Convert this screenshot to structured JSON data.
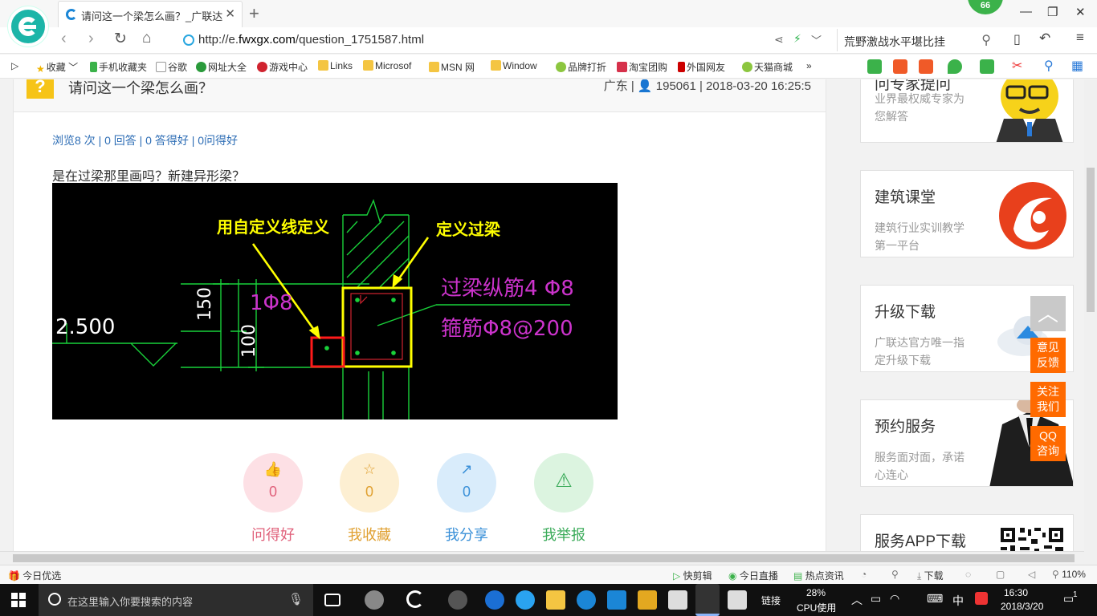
{
  "browser": {
    "tab_title": "请问这一个梁怎么画？_广联达服",
    "badge": "66",
    "url_prefix": "http://e.",
    "url_domain": "fwxgx.com",
    "url_path": "/question_1751587.html",
    "search_text": "荒野激战水平堪比挂",
    "bookmarks": [
      "收藏",
      "手机收藏夹",
      "谷歌",
      "网址大全",
      "游戏中心",
      "Links",
      "Microsof",
      "MSN 网",
      "Window",
      "品牌打折",
      "淘宝团购",
      "外国网友",
      "天猫商城"
    ]
  },
  "question": {
    "mark": "?",
    "title": "请问这一个梁怎么画？",
    "meta": "广东 | 👤 195061 | 2018-03-20 16:25:5",
    "stats": "浏览8 次 | 0 回答 | 0 答得好 | 0问得好",
    "body": "是在过梁那里画吗？新建异形梁？"
  },
  "cad": {
    "label_left": "用自定义线定义",
    "label_right": "定义过梁",
    "elev": "2.500",
    "dim_150": "150",
    "dim_100": "100",
    "rebar_small": "1Φ8",
    "rebar_long": "过梁纵筋4 Φ8",
    "stirrup": "箍筋Φ8@200"
  },
  "actions": [
    {
      "label": "问得好",
      "count": "0",
      "color": "#e0607a",
      "bg": "#fde0e5",
      "icon": "thumbs-up-icon",
      "glyph": "👍"
    },
    {
      "label": "我收藏",
      "count": "0",
      "color": "#e0a030",
      "bg": "#fdefd2",
      "icon": "star-icon",
      "glyph": "☆"
    },
    {
      "label": "我分享",
      "count": "0",
      "color": "#3a90d8",
      "bg": "#d9ecfb",
      "icon": "share-icon",
      "glyph": "↗"
    },
    {
      "label": "我举报",
      "count": "",
      "color": "#3bab5a",
      "bg": "#dcf4e0",
      "icon": "warning-icon",
      "glyph": "⚠"
    }
  ],
  "sidebar": [
    {
      "title": "问专家提问",
      "desc": "业界最权威专家为您解答"
    },
    {
      "title": "建筑课堂",
      "desc": "建筑行业实训教学第一平台"
    },
    {
      "title": "升级下载",
      "desc": "广联达官方唯一指定升级下载"
    },
    {
      "title": "预约服务",
      "desc": "服务面对面，承诺心连心"
    },
    {
      "title": "服务APP下载",
      "desc": ""
    }
  ],
  "float_buttons": [
    "意见反馈",
    "关注我们",
    "QQ咨询"
  ],
  "statusbar": {
    "left": "今日优选",
    "items": [
      "快剪辑",
      "今日直播",
      "热点资讯",
      "下载"
    ],
    "zoom": "110%"
  },
  "taskbar": {
    "search_placeholder": "在这里输入你要搜索的内容",
    "tray_link": "链接",
    "cpu_percent": "28%",
    "cpu_label": "CPU使用",
    "ime": "中",
    "time": "16:30",
    "date": "2018/3/20",
    "notifications": "1"
  }
}
